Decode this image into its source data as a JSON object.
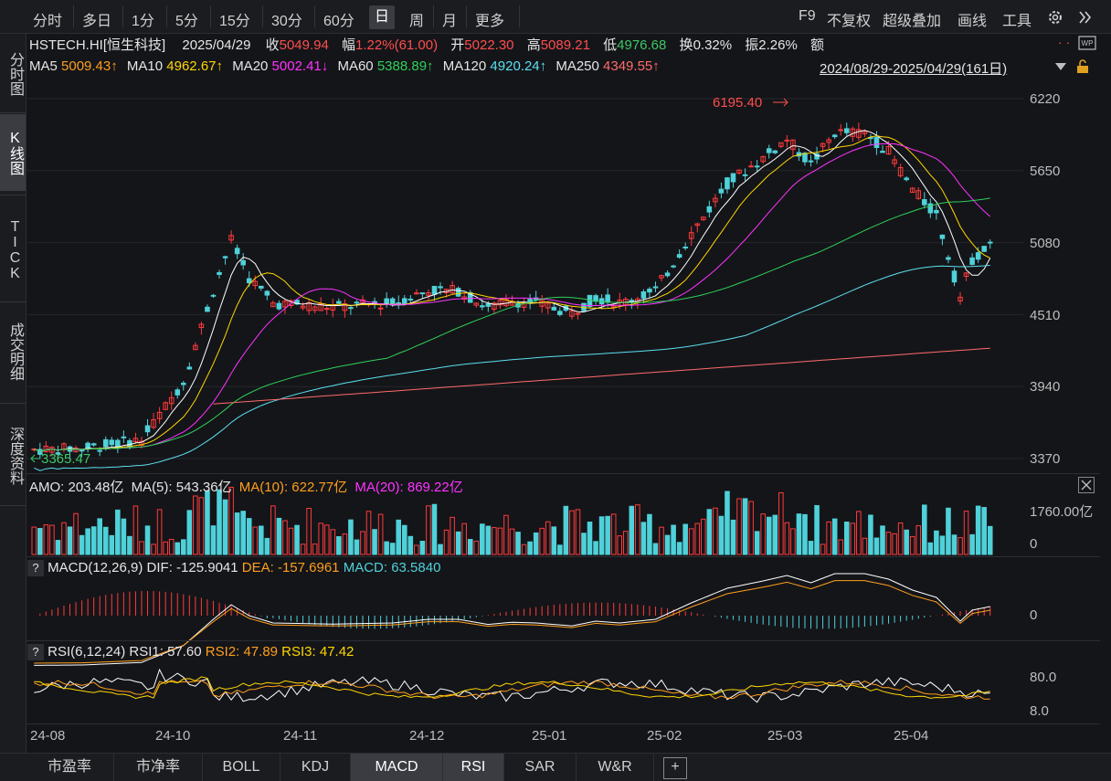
{
  "toolbar": {
    "periods": [
      "分时",
      "多日",
      "1分",
      "5分",
      "15分",
      "30分",
      "60分",
      "日",
      "周",
      "月",
      "更多"
    ],
    "active": "日",
    "right": [
      "F9",
      "不复权",
      "超级叠加",
      "画线",
      "工具"
    ]
  },
  "leftnav": [
    "分时图",
    "K线图",
    "TICK",
    "成交明细",
    "深度资料"
  ],
  "info": {
    "symbol": "HSTECH.HI[恒生科技]",
    "date": "2025/04/29",
    "close_label": "收",
    "close": "5049.94",
    "change_label": "幅",
    "change": "1.22%(61.00)",
    "open_label": "开",
    "open": "5022.30",
    "high_label": "高",
    "high": "5089.21",
    "low_label": "低",
    "low": "4976.68",
    "turnover_label": "换",
    "turnover": "0.32%",
    "amplitude_label": "振",
    "amplitude": "2.26%",
    "amount_label": "额"
  },
  "ma": {
    "ma5_label": "MA5",
    "ma5": "5009.43↑",
    "ma10_label": "MA10",
    "ma10": "4962.67↑",
    "ma20_label": "MA20",
    "ma20": "5002.41↓",
    "ma60_label": "MA60",
    "ma60": "5388.89↑",
    "ma120_label": "MA120",
    "ma120": "4920.24↑",
    "ma250_label": "MA250",
    "ma250": "4349.55↑",
    "range": "2024/08/29-2025/04/29(161日)"
  },
  "annotations": {
    "high": "6195.40",
    "low": "3365.47"
  },
  "price_axis": [
    "6220",
    "5650",
    "5080",
    "4510",
    "3940",
    "3370"
  ],
  "volume": {
    "amo": "AMO: 203.48亿",
    "ma5": "MA(5): 543.36亿",
    "ma10": "MA(10): 622.77亿",
    "ma20": "MA(20): 869.22亿",
    "axis_top": "1760.00亿",
    "axis_zero": "0"
  },
  "macd": {
    "title": "MACD(12,26,9)",
    "dif": "DIF: -125.9041",
    "dea": "DEA: -157.6961",
    "macd": "MACD: 63.5840",
    "axis_zero": "0"
  },
  "rsi": {
    "title": "RSI(6,12,24)",
    "rsi1": "RSI1: 57.60",
    "rsi2": "RSI2: 47.89",
    "rsi3": "RSI3: 47.42",
    "axis_top": "80.0",
    "axis_bottom": "8.0"
  },
  "x_axis": [
    "24-08",
    "24-10",
    "24-11",
    "24-12",
    "25-01",
    "25-02",
    "25-03",
    "25-04"
  ],
  "bottom_tabs": [
    "市盈率",
    "市净率",
    "BOLL",
    "KDJ",
    "MACD",
    "RSI",
    "SAR",
    "W&R"
  ],
  "bottom_active": "MACD",
  "colors": {
    "up": "#ff3b3b",
    "down": "#4fd1d9",
    "ma5": "#ffffff",
    "ma10": "#ffd700",
    "ma20": "#ff33ff",
    "ma60": "#2fd15a",
    "ma120": "#5ce0f0",
    "ma250": "#ff6b6b"
  }
}
